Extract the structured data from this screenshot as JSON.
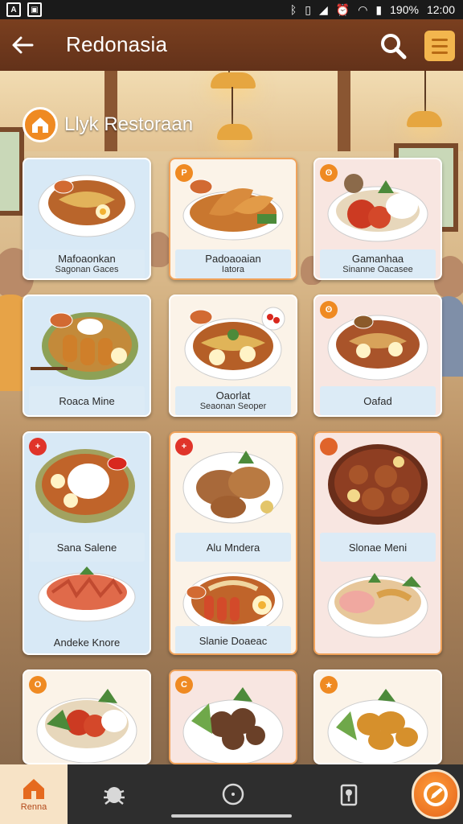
{
  "status_bar": {
    "battery": "190%",
    "time": "12:00",
    "left_icons": [
      "a-icon",
      "image-icon"
    ],
    "right_icons": [
      "bluetooth-icon",
      "vibrate-icon",
      "signal-icon",
      "alarm-icon",
      "wifi-icon",
      "battery-icon"
    ]
  },
  "app_bar": {
    "title": "Redonasia",
    "back_icon": "arrow-left-icon",
    "search_icon": "search-icon",
    "menu_icon": "menu-icon"
  },
  "restaurant": {
    "title": "Llyk Restoraan",
    "icon": "home-icon"
  },
  "menu_cards": [
    {
      "line1": "Mafoaonkan",
      "line2": "Sagonan Gaces"
    },
    {
      "line1": "Padoaoaian",
      "line2": "Iatora"
    },
    {
      "line1": "Gamanhaa",
      "line2": "Sinanne Oacasee"
    },
    {
      "line1": "Roaca Mine",
      "line2": ""
    },
    {
      "line1": "Oaorlat",
      "line2": "Seaonan Seoper"
    },
    {
      "line1": "Oafad",
      "line2": ""
    },
    {
      "line1": "Sana Salene",
      "line2": ""
    },
    {
      "line1": "Alu Mndera",
      "line2": ""
    },
    {
      "line1": "Slonae Meni",
      "line2": ""
    },
    {
      "line1": "Andeke Knore",
      "line2": ""
    },
    {
      "line1": "Slanie Doaeac",
      "line2": ""
    }
  ],
  "bottom_nav": {
    "home_label": "Renna",
    "home_icon": "home-icon",
    "items": [
      "bug-icon",
      "circle-icon",
      "location-icon"
    ],
    "fab_icon": "edit-icon"
  },
  "colors": {
    "app_bar": "#7a3f1f",
    "accent": "#ef8a22",
    "menu_button": "#f3b64e",
    "nav_bar": "#2e2e2e"
  }
}
